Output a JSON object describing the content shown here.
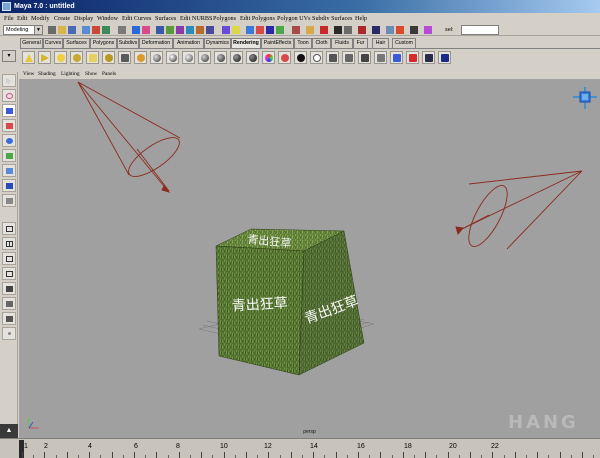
{
  "window": {
    "title": "Maya 7.0 : untitled"
  },
  "menu": {
    "items": [
      "File",
      "Edit",
      "Modify",
      "Create",
      "Display",
      "Window",
      "Edit Curves",
      "Surfaces",
      "Edit NURBS",
      "Polygons",
      "Edit Polygons",
      "Polygon UVs",
      "Subdiv Surfaces",
      "Help"
    ]
  },
  "status_line": {
    "mode_value": "Modeling",
    "sel_label": "sel:"
  },
  "shelf": {
    "tabs": [
      "General",
      "Curves",
      "Surfaces",
      "Polygons",
      "Subdivs",
      "Deformation",
      "Animation",
      "Dynamics",
      "Rendering",
      "PaintEffects",
      "Toon",
      "Cloth",
      "Fluids",
      "Fur",
      "Hair",
      "Custom"
    ],
    "active_tab": "Rendering"
  },
  "panel_menu": {
    "items": [
      "View",
      "Shading",
      "Lighting",
      "Show",
      "Panels"
    ]
  },
  "viewport": {
    "camera_label": "persp",
    "cube_text_top": "青出狂草",
    "cube_text_left": "青出狂草",
    "cube_text_right": "青出狂草",
    "watermark": "HANG"
  },
  "time_slider": {
    "tick_labels": [
      "1",
      "2",
      "4",
      "6",
      "8",
      "10",
      "12",
      "14",
      "16",
      "18",
      "20",
      "22"
    ]
  },
  "colors": {
    "viewport_bg": "#a0a0a0",
    "light_cone": "#8b2a1e",
    "grass_dark": "#3e5a22",
    "grass_light": "#7a9a4a",
    "title_bar": "#0a246a"
  }
}
